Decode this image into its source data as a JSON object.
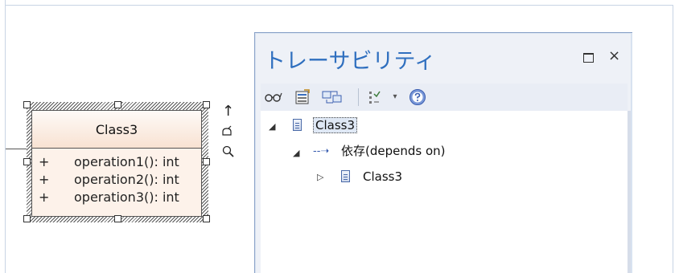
{
  "diagram": {
    "class_name": "Class3",
    "operations": [
      {
        "visibility": "+",
        "signature": "operation1(): int"
      },
      {
        "visibility": "+",
        "signature": "operation2(): int"
      },
      {
        "visibility": "+",
        "signature": "operation3(): int"
      }
    ],
    "side_icons": [
      "arrow-up-icon",
      "bell-icon",
      "magnifier-icon"
    ]
  },
  "panel": {
    "title": "トレーサビリティ",
    "close_glyph": "×",
    "toolbar_icons": [
      "glasses-icon",
      "properties-icon",
      "refresh-icon",
      "filter-icon",
      "dropdown-icon",
      "help-icon"
    ]
  },
  "tree": {
    "root": {
      "label": "Class3",
      "expanded": true
    },
    "relation": {
      "label": "依存(depends on)",
      "expanded": true
    },
    "child": {
      "label": "Class3",
      "expanded": false
    }
  }
}
